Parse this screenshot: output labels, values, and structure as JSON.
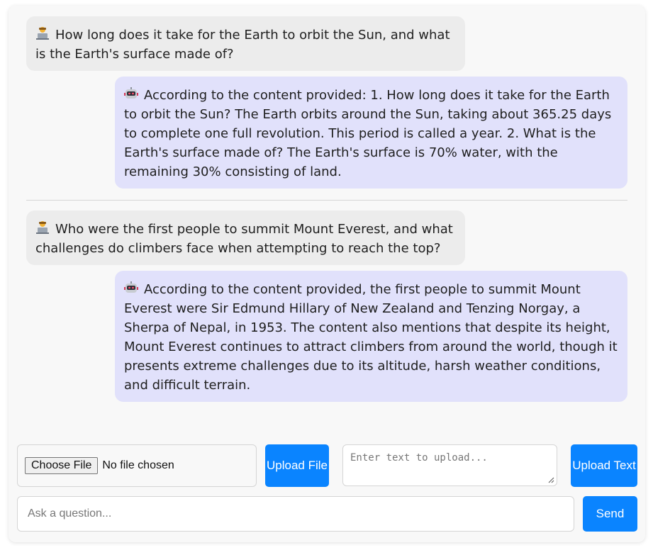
{
  "messages": [
    {
      "role": "user",
      "icon": "user-laptop-icon",
      "text": "How long does it take for the Earth to orbit the Sun, and what is the Earth's surface made of?"
    },
    {
      "role": "bot",
      "icon": "robot-icon",
      "text": "According to the content provided: 1. How long does it take for the Earth to orbit the Sun? The Earth orbits around the Sun, taking about 365.25 days to complete one full revolution. This period is called a year. 2. What is the Earth's surface made of? The Earth's surface is 70% water, with the remaining 30% consisting of land."
    },
    {
      "role": "user",
      "icon": "user-laptop-icon",
      "text": "Who were the first people to summit Mount Everest, and what challenges do climbers face when attempting to reach the top?"
    },
    {
      "role": "bot",
      "icon": "robot-icon",
      "text": "According to the content provided, the first people to summit Mount Everest were Sir Edmund Hillary of New Zealand and Tenzing Norgay, a Sherpa of Nepal, in 1953. The content also mentions that despite its height, Mount Everest continues to attract climbers from around the world, though it presents extreme challenges due to its altitude, harsh weather conditions, and difficult terrain."
    }
  ],
  "upload": {
    "choose_file_label": "Choose File",
    "file_status": "No file chosen",
    "upload_file_label": "Upload File",
    "text_placeholder": "Enter text to upload...",
    "upload_text_label": "Upload Text"
  },
  "ask": {
    "placeholder": "Ask a question...",
    "send_label": "Send"
  },
  "colors": {
    "accent": "#0a84ff",
    "user_bubble": "#ececec",
    "bot_bubble": "#e1e1fb"
  }
}
